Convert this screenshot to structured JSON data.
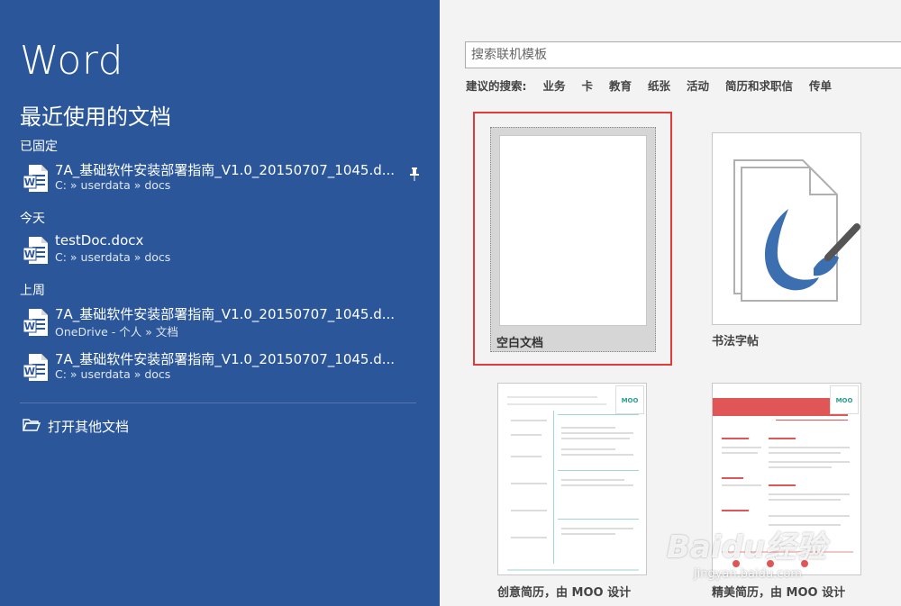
{
  "app": {
    "title": "Word"
  },
  "left": {
    "recent_title": "最近使用的文档",
    "groups": [
      {
        "label": "已固定"
      },
      {
        "label": "今天"
      },
      {
        "label": "上周"
      }
    ],
    "docs": [
      {
        "name": "7A_基础软件安装部署指南_V1.0_20150707_1045.d...",
        "path": "C: » userdata » docs",
        "icon": "word-doc-icon",
        "pinned": true
      },
      {
        "name": "testDoc.docx",
        "path": "C: » userdata » docs",
        "icon": "word-doc-icon"
      },
      {
        "name": "7A_基础软件安装部署指南_V1.0_20150707_1045.d...",
        "path": "OneDrive - 个人 » 文档",
        "icon": "word-doc-icon"
      },
      {
        "name": "7A_基础软件安装部署指南_V1.0_20150707_1045.d...",
        "path": "C: » userdata » docs",
        "icon": "word-doc-icon"
      }
    ],
    "open_other": "打开其他文档"
  },
  "right": {
    "search_placeholder": "搜索联机模板",
    "suggest_label": "建议的搜索:",
    "suggest_tags": [
      "业务",
      "卡",
      "教育",
      "纸张",
      "活动",
      "简历和求职信",
      "传单"
    ],
    "templates": [
      {
        "caption": "空白文档"
      },
      {
        "caption": "书法字帖"
      },
      {
        "caption": "创意简历，由 MOO 设计"
      },
      {
        "caption": "精美简历，由 MOO 设计"
      }
    ],
    "moo_logo": "MOO"
  },
  "watermark": {
    "main": "Baidu经验",
    "sub": "jingyan.baidu.com"
  },
  "colors": {
    "sidebar": "#2b579a",
    "highlight": "#e03a3a",
    "accent_teal": "#2a9d8f",
    "accent_red": "#e05555"
  }
}
